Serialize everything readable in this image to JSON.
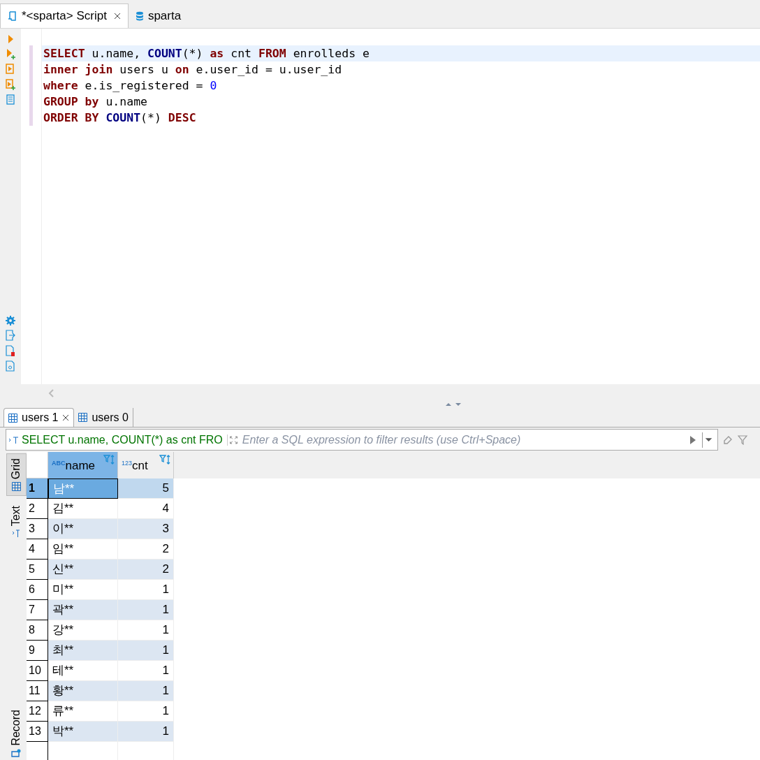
{
  "editor_tabs": [
    {
      "label": "*<sparta> Script",
      "selected": true
    },
    {
      "label": "sparta",
      "selected": false
    }
  ],
  "sql_lines": [
    [
      {
        "text": "SELECT",
        "kind": "keyword"
      },
      {
        "text": " u.name, ",
        "kind": "plain"
      },
      {
        "text": "COUNT",
        "kind": "function"
      },
      {
        "text": "(*) ",
        "kind": "plain"
      },
      {
        "text": "as",
        "kind": "keyword"
      },
      {
        "text": " cnt ",
        "kind": "plain"
      },
      {
        "text": "FROM",
        "kind": "keyword"
      },
      {
        "text": " enrolleds e",
        "kind": "plain"
      }
    ],
    [
      {
        "text": "inner join",
        "kind": "keyword"
      },
      {
        "text": " users u ",
        "kind": "plain"
      },
      {
        "text": "on",
        "kind": "keyword"
      },
      {
        "text": " e.user_id = u.user_id",
        "kind": "plain"
      }
    ],
    [
      {
        "text": "where",
        "kind": "keyword"
      },
      {
        "text": " e.is_registered = ",
        "kind": "plain"
      },
      {
        "text": "0",
        "kind": "number"
      }
    ],
    [
      {
        "text": "GROUP by",
        "kind": "keyword"
      },
      {
        "text": " u.name",
        "kind": "plain"
      }
    ],
    [
      {
        "text": "ORDER BY",
        "kind": "keyword"
      },
      {
        "text": " COUNT",
        "kind": "function"
      },
      {
        "text": "(*) ",
        "kind": "plain"
      },
      {
        "text": "DESC",
        "kind": "keyword"
      }
    ]
  ],
  "result_tabs": [
    {
      "label": "users 1",
      "selected": true
    },
    {
      "label": "users 0",
      "selected": false
    }
  ],
  "filter": {
    "query": "SELECT u.name, COUNT(*) as cnt FRO",
    "placeholder": "Enter a SQL expression to filter results (use Ctrl+Space)"
  },
  "side_tabs": [
    {
      "label": "Grid",
      "selected": true
    },
    {
      "label": "Text",
      "selected": false
    }
  ],
  "record_tab": {
    "label": "Record"
  },
  "table": {
    "columns": [
      {
        "label": "name",
        "type": "ABC"
      },
      {
        "label": "cnt",
        "type": "123"
      }
    ],
    "rows": [
      {
        "num": "1",
        "cells": [
          "남**",
          "5"
        ],
        "selected": true
      },
      {
        "num": "2",
        "cells": [
          "김**",
          "4"
        ],
        "selected": false
      },
      {
        "num": "3",
        "cells": [
          "이**",
          "3"
        ],
        "selected": false
      },
      {
        "num": "4",
        "cells": [
          "임**",
          "2"
        ],
        "selected": false
      },
      {
        "num": "5",
        "cells": [
          "신**",
          "2"
        ],
        "selected": false
      },
      {
        "num": "6",
        "cells": [
          "미**",
          "1"
        ],
        "selected": false
      },
      {
        "num": "7",
        "cells": [
          "곽**",
          "1"
        ],
        "selected": false
      },
      {
        "num": "8",
        "cells": [
          "강**",
          "1"
        ],
        "selected": false
      },
      {
        "num": "9",
        "cells": [
          "최**",
          "1"
        ],
        "selected": false
      },
      {
        "num": "10",
        "cells": [
          "테**",
          "1"
        ],
        "selected": false
      },
      {
        "num": "11",
        "cells": [
          "황**",
          "1"
        ],
        "selected": false
      },
      {
        "num": "12",
        "cells": [
          "류**",
          "1"
        ],
        "selected": false
      },
      {
        "num": "13",
        "cells": [
          "박**",
          "1"
        ],
        "selected": false
      }
    ]
  }
}
